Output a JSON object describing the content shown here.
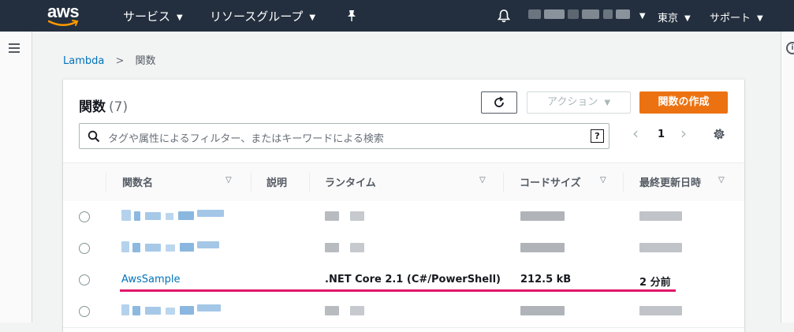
{
  "topnav": {
    "logo_text": "aws",
    "services_label": "サービス",
    "resource_groups_label": "リソースグループ",
    "region_label": "東京",
    "support_label": "サポート"
  },
  "breadcrumb": {
    "root": "Lambda",
    "separator": ">",
    "current": "関数"
  },
  "panel": {
    "title": "関数",
    "count": "(7)",
    "actions_label": "アクション",
    "create_label": "関数の作成",
    "search_placeholder": "タグや属性によるフィルター、またはキーワードによる検索",
    "help_glyph": "?",
    "page_number": "1",
    "prev_glyph": "‹",
    "next_glyph": "›"
  },
  "table": {
    "columns": [
      "関数名",
      "説明",
      "ランタイム",
      "コードサイズ",
      "最終更新日時"
    ],
    "visible_row": {
      "name": "AwsSample",
      "runtime": ".NET Core 2.1 (C#/PowerShell)",
      "code_size": "212.5 kB",
      "last_modified": "2 分前"
    }
  },
  "colors": {
    "nav_bg": "#232f3e",
    "link": "#0073bb",
    "primary_button": "#ec7211",
    "annotation_underline": "#e0166b"
  },
  "icons": [
    "bell-icon",
    "pin-icon",
    "menu-icon",
    "info-icon",
    "refresh-icon",
    "search-icon",
    "help-icon",
    "gear-icon"
  ]
}
